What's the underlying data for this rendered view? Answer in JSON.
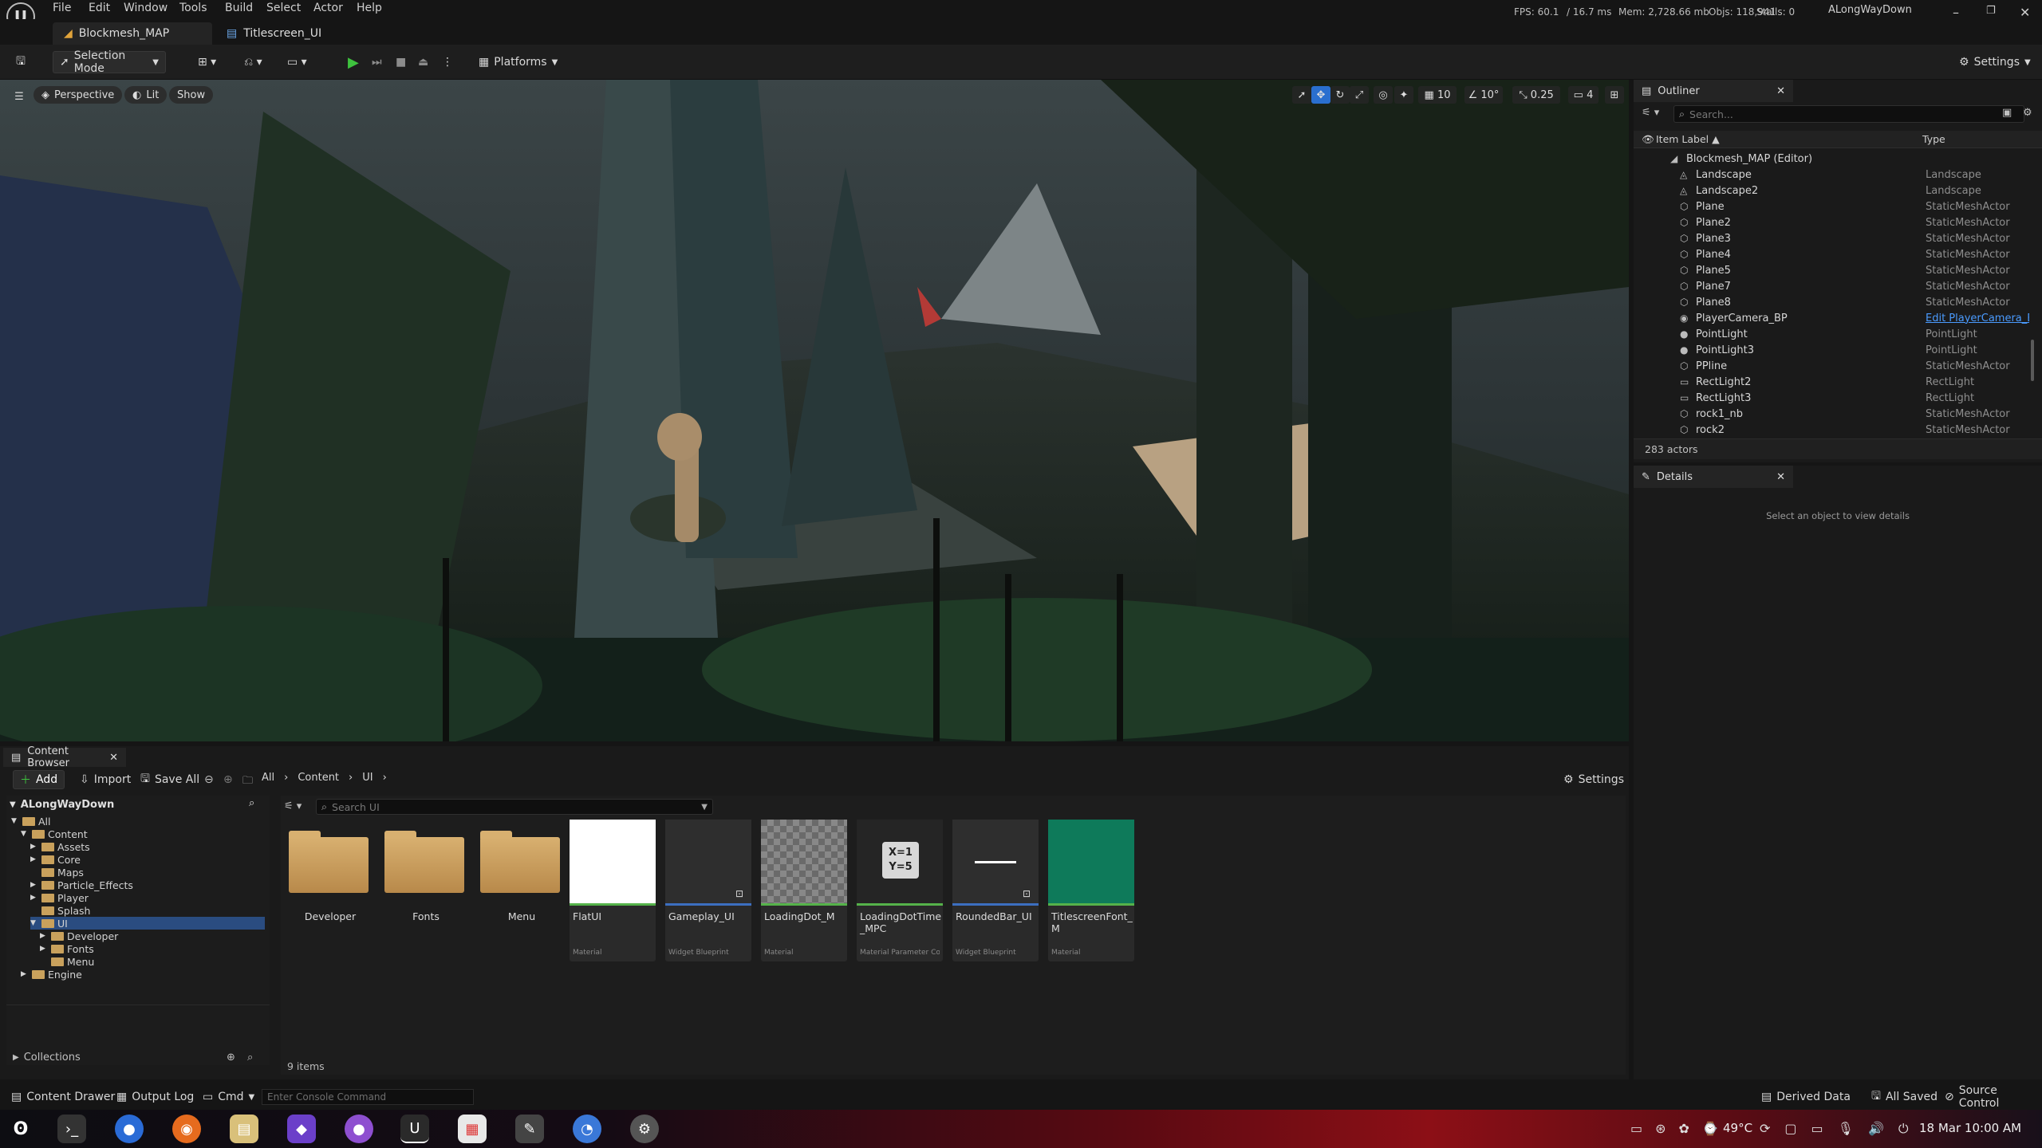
{
  "menu": {
    "items": [
      "File",
      "Edit",
      "Window",
      "Tools",
      "Build",
      "Select",
      "Actor",
      "Help"
    ]
  },
  "stats": {
    "fps": "FPS: 60.1",
    "frame": "/ 16.7 ms",
    "mem": "Mem: 2,728.66 mb",
    "objs": "Objs: 118,941",
    "stalls": "Stalls: 0",
    "project": "ALongWayDown"
  },
  "tabs": [
    {
      "label": "Blockmesh_MAP"
    },
    {
      "label": "Titlescreen_UI"
    }
  ],
  "toolbar": {
    "selection_mode": "Selection Mode",
    "platforms": "Platforms",
    "settings": "Settings"
  },
  "viewport": {
    "perspective": "Perspective",
    "lit": "Lit",
    "show": "Show",
    "grid_size": "10",
    "rot_snap": "10°",
    "scale_snap": "0.25",
    "camera_speed": "4"
  },
  "outliner": {
    "title": "Outliner",
    "search_placeholder": "Search...",
    "col_label": "Item Label",
    "col_type": "Type",
    "root": "Blockmesh_MAP (Editor)",
    "rows": [
      {
        "name": "Landscape",
        "type": "Landscape"
      },
      {
        "name": "Landscape2",
        "type": "Landscape"
      },
      {
        "name": "Plane",
        "type": "StaticMeshActor"
      },
      {
        "name": "Plane2",
        "type": "StaticMeshActor"
      },
      {
        "name": "Plane3",
        "type": "StaticMeshActor"
      },
      {
        "name": "Plane4",
        "type": "StaticMeshActor"
      },
      {
        "name": "Plane5",
        "type": "StaticMeshActor"
      },
      {
        "name": "Plane7",
        "type": "StaticMeshActor"
      },
      {
        "name": "Plane8",
        "type": "StaticMeshActor"
      },
      {
        "name": "PlayerCamera_BP",
        "type": "Edit PlayerCamera_BP"
      },
      {
        "name": "PointLight",
        "type": "PointLight"
      },
      {
        "name": "PointLight3",
        "type": "PointLight"
      },
      {
        "name": "PPline",
        "type": "StaticMeshActor"
      },
      {
        "name": "RectLight2",
        "type": "RectLight"
      },
      {
        "name": "RectLight3",
        "type": "RectLight"
      },
      {
        "name": "rock1_nb",
        "type": "StaticMeshActor"
      },
      {
        "name": "rock2",
        "type": "StaticMeshActor"
      }
    ],
    "count": "283 actors"
  },
  "details": {
    "title": "Details",
    "empty": "Select an object to view details"
  },
  "content_browser": {
    "title": "Content Browser",
    "add": "Add",
    "import": "Import",
    "save_all": "Save All",
    "breadcrumb": [
      "All",
      "Content",
      "UI"
    ],
    "settings": "Settings",
    "search_placeholder": "Search UI",
    "project": "ALongWayDown",
    "tree": [
      {
        "label": "All",
        "indent": 0
      },
      {
        "label": "Content",
        "indent": 1
      },
      {
        "label": "Assets",
        "indent": 2
      },
      {
        "label": "Core",
        "indent": 2
      },
      {
        "label": "Maps",
        "indent": 2
      },
      {
        "label": "Particle_Effects",
        "indent": 2
      },
      {
        "label": "Player",
        "indent": 2
      },
      {
        "label": "Splash",
        "indent": 2
      },
      {
        "label": "UI",
        "indent": 2
      },
      {
        "label": "Developer",
        "indent": 3
      },
      {
        "label": "Fonts",
        "indent": 3
      },
      {
        "label": "Menu",
        "indent": 3
      },
      {
        "label": "Engine",
        "indent": 1
      }
    ],
    "collections": "Collections",
    "assets": [
      {
        "name": "Developer",
        "class": ""
      },
      {
        "name": "Fonts",
        "class": ""
      },
      {
        "name": "Menu",
        "class": ""
      },
      {
        "name": "FlatUI",
        "class": "Material"
      },
      {
        "name": "Gameplay_UI",
        "class": "Widget Blueprint"
      },
      {
        "name": "LoadingDot_M",
        "class": "Material"
      },
      {
        "name": "LoadingDotTime_MPC",
        "class": "Material Parameter Coll..."
      },
      {
        "name": "RoundedBar_UI",
        "class": "Widget Blueprint"
      },
      {
        "name": "TitlescreenFont_M",
        "class": "Material"
      }
    ],
    "mpc_thumb": "X=1\nY=5",
    "item_count": "9 items"
  },
  "statusbar": {
    "content_drawer": "Content Drawer",
    "output_log": "Output Log",
    "cmd": "Cmd",
    "console_placeholder": "Enter Console Command",
    "derived_data": "Derived Data",
    "all_saved": "All Saved",
    "source_control": "Source Control"
  },
  "taskbar": {
    "temp": "49°C",
    "datetime": "18 Mar  10:00 AM"
  }
}
